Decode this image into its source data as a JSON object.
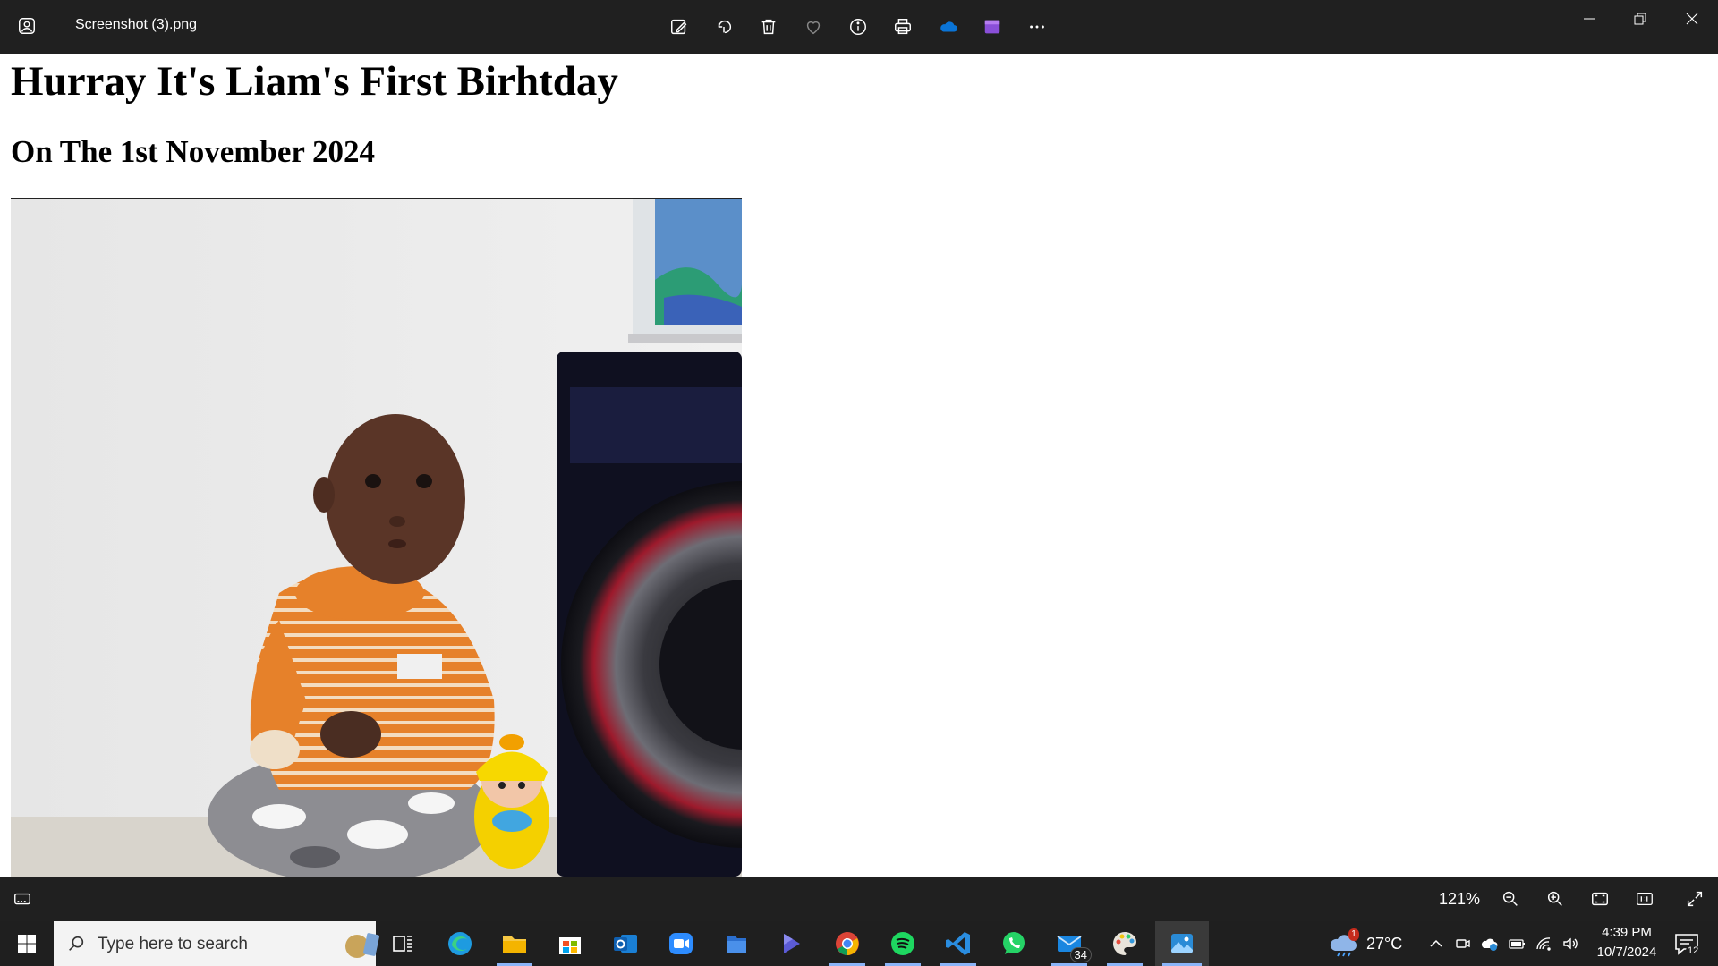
{
  "titlebar": {
    "file_name": "Screenshot (3).png",
    "actions": [
      "edit-image",
      "rotate",
      "delete",
      "favorite",
      "file-info",
      "print",
      "onedrive",
      "video-editor",
      "more"
    ]
  },
  "document": {
    "heading": "Hurray It's Liam's First Birhtday",
    "subheading": "On The 1st November 2024"
  },
  "viewer": {
    "zoom": "121%"
  },
  "taskbar": {
    "search_placeholder": "Type here to search",
    "mail_badge": "34",
    "weather_temp": "27°C",
    "weather_alert": "1",
    "time": "4:39 PM",
    "date": "10/7/2024",
    "notification_count": "12"
  },
  "colors": {
    "titlebar_bg": "#202020",
    "taskbar_bg": "#1f1f1f",
    "accent": "#0078d4"
  }
}
